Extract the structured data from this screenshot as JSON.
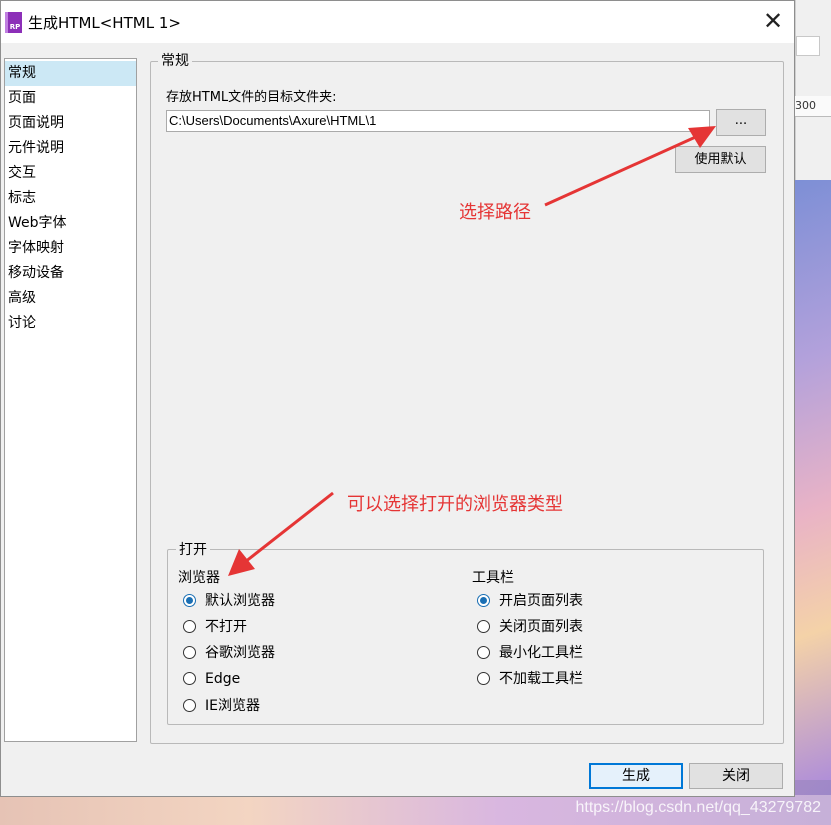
{
  "window": {
    "title": "生成HTML<HTML 1>",
    "app_icon_text": "RP",
    "close_glyph": "✕"
  },
  "background": {
    "ruler_mark": "300",
    "watermark": "https://blog.csdn.net/qq_43279782"
  },
  "nav": {
    "items": [
      {
        "label": "常规",
        "selected": true
      },
      {
        "label": "页面"
      },
      {
        "label": "页面说明"
      },
      {
        "label": "元件说明"
      },
      {
        "label": "交互"
      },
      {
        "label": "标志"
      },
      {
        "label": "Web字体"
      },
      {
        "label": "字体映射"
      },
      {
        "label": "移动设备"
      },
      {
        "label": "高级"
      },
      {
        "label": "讨论"
      }
    ]
  },
  "general": {
    "legend": "常规",
    "folder_label": "存放HTML文件的目标文件夹:",
    "folder_path": "C:\\Users\\Documents\\Axure\\HTML\\1",
    "browse_label": "...",
    "use_default_label": "使用默认"
  },
  "annotations": {
    "choose_path": "选择路径",
    "choose_browser": "可以选择打开的浏览器类型",
    "color": "#e53535"
  },
  "open": {
    "legend": "打开",
    "browser": {
      "heading": "浏览器",
      "options": [
        "默认浏览器",
        "不打开",
        "谷歌浏览器",
        "Edge",
        "IE浏览器"
      ],
      "selected": "默认浏览器"
    },
    "toolbar": {
      "heading": "工具栏",
      "options": [
        "开启页面列表",
        "关闭页面列表",
        "最小化工具栏",
        "不加载工具栏"
      ],
      "selected": "开启页面列表"
    }
  },
  "footer": {
    "generate_label": "生成",
    "close_label": "关闭"
  },
  "colors": {
    "accent": "#0078d7",
    "selection": "#cce8f5",
    "radio_checked": "#1a6fb4"
  }
}
